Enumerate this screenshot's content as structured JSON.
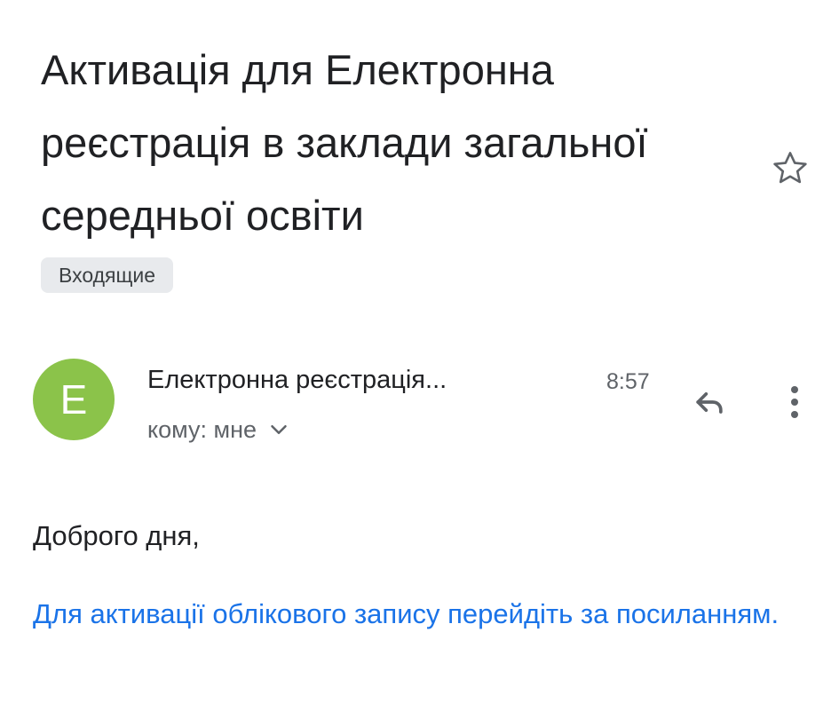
{
  "email": {
    "subject": "Активація для Електронна реєстрація в заклади загальної середньої освіти",
    "label": "Входящие",
    "sender": {
      "initial": "Е",
      "name": "Електронна реєстрація...",
      "time": "8:57",
      "recipient": "кому: мне",
      "avatar_color": "#8bc34a"
    },
    "body": {
      "greeting": "Доброго дня,",
      "activation_link_text": "Для активації облікового запису перейдіть за посиланням."
    }
  },
  "icons": {
    "star": "star-outline-icon",
    "reply": "reply-icon",
    "more": "more-vert-icon",
    "expand": "chevron-down-icon"
  },
  "colors": {
    "link": "#1a73e8",
    "chip_bg": "#e8eaed"
  }
}
